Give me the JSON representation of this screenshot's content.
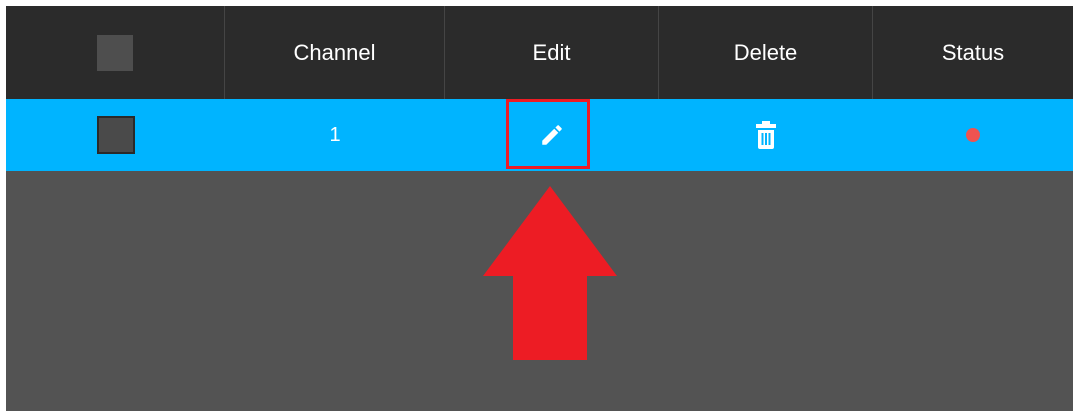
{
  "table": {
    "header": {
      "channel_label": "Channel",
      "edit_label": "Edit",
      "delete_label": "Delete",
      "status_label": "Status"
    },
    "rows": [
      {
        "channel": "1",
        "selected": false,
        "status_color": "#ef5350"
      }
    ]
  },
  "colors": {
    "header_bg": "#2b2b2b",
    "row_highlight": "#00b4ff",
    "body_bg": "#535353",
    "annotation_red": "#ed1c24"
  },
  "icons": {
    "edit": "pencil-icon",
    "delete": "trash-icon",
    "annotation": "arrow-up-icon"
  }
}
